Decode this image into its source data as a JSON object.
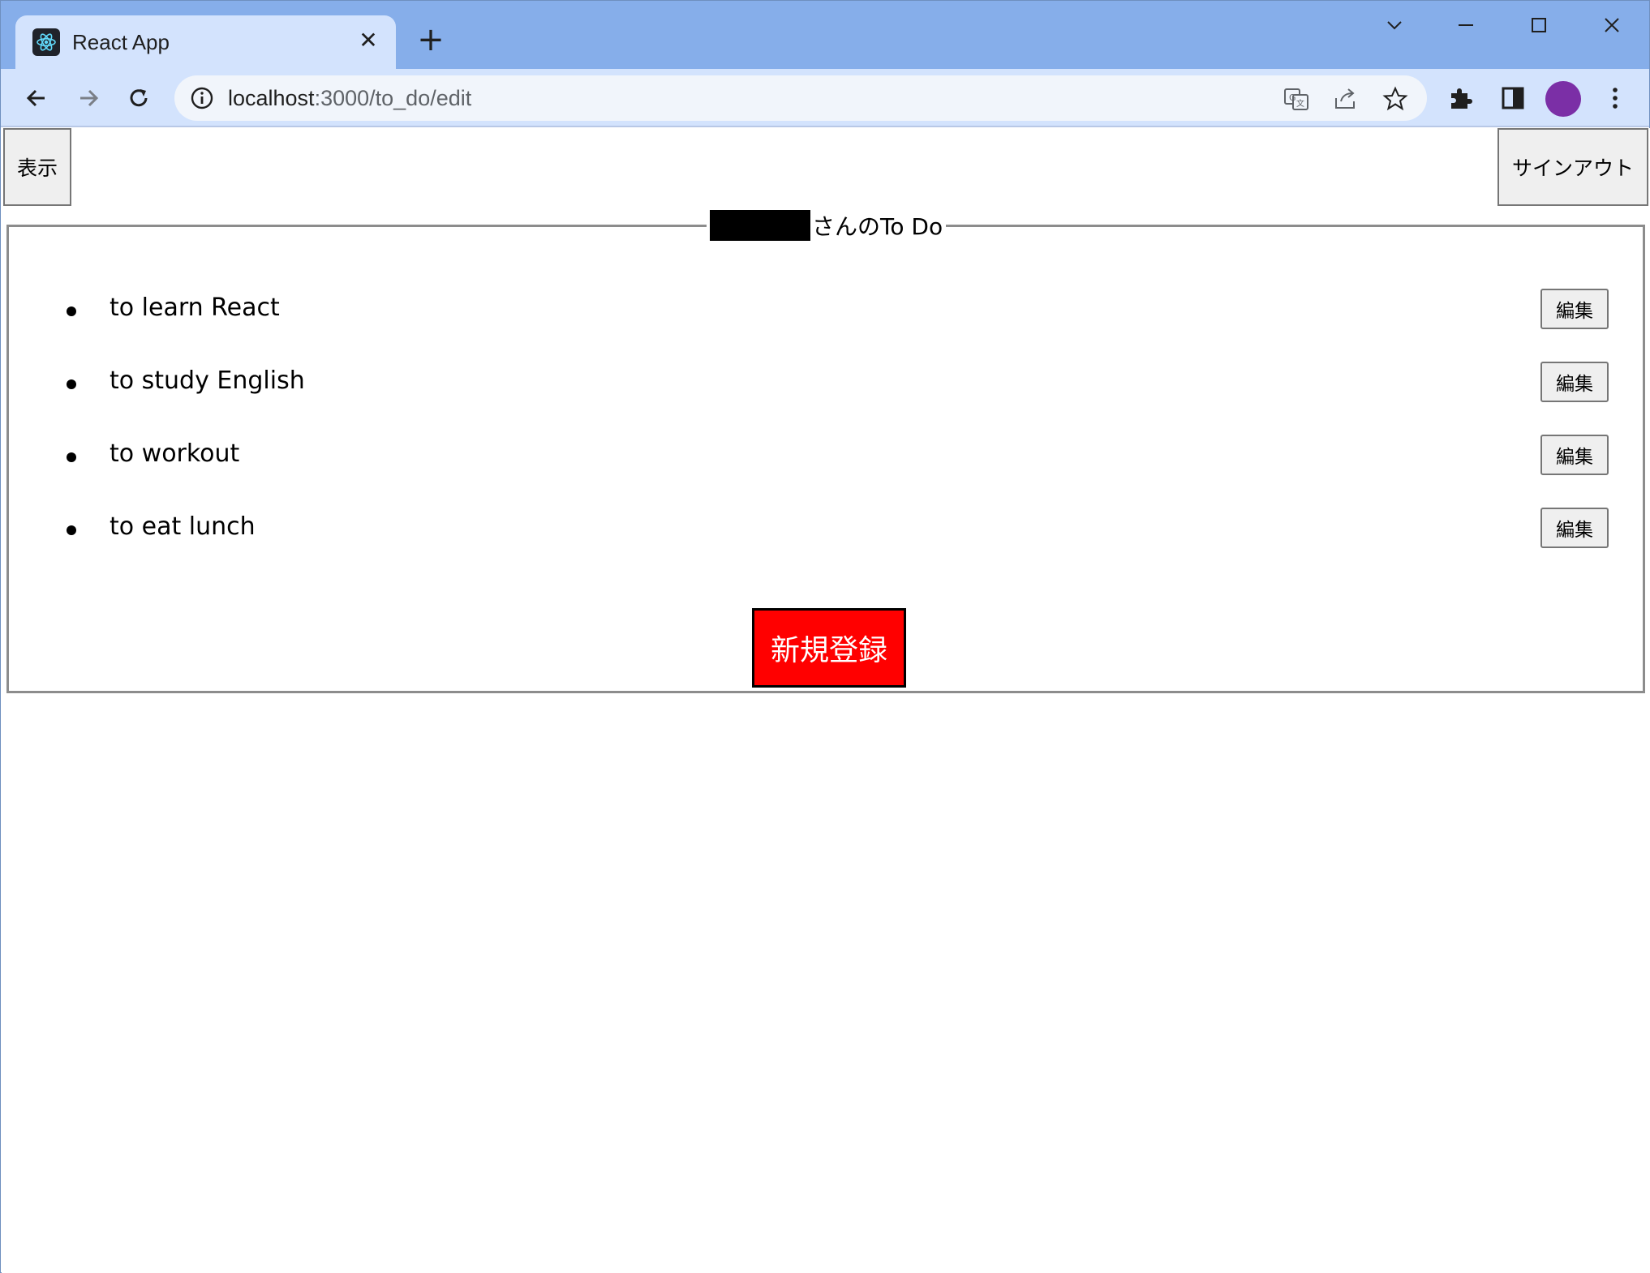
{
  "browser": {
    "tab_title": "React App",
    "tab_close": "✕",
    "new_tab": "+",
    "url_host": "localhost",
    "url_path": ":3000/to_do/edit",
    "profile_color": "#7b2fa6"
  },
  "header": {
    "show_button": "表示",
    "signout_button": "サインアウト"
  },
  "todo_panel": {
    "legend_suffix": "さんのTo Do",
    "items": [
      {
        "text": "to learn React",
        "edit_label": "編集"
      },
      {
        "text": "to study English",
        "edit_label": "編集"
      },
      {
        "text": "to workout",
        "edit_label": "編集"
      },
      {
        "text": "to eat lunch",
        "edit_label": "編集"
      }
    ],
    "new_button": "新規登録",
    "new_button_color": "#ff0000"
  }
}
